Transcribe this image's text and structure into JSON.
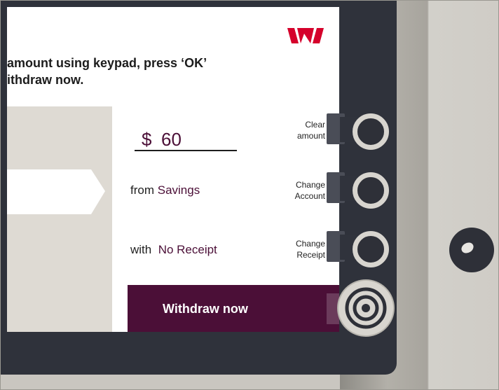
{
  "brand": {
    "logo_icon": "westpac-logo",
    "color": "#d5002b"
  },
  "instructions": {
    "line1": "amount using keypad, press ‘OK’",
    "line2": "ithdraw now."
  },
  "amount": {
    "currency": "$",
    "value": "60"
  },
  "from": {
    "label": "from",
    "value": "Savings"
  },
  "with": {
    "label": "with",
    "value": "No Receipt"
  },
  "side_buttons": {
    "clear": {
      "line1": "Clear",
      "line2": "amount"
    },
    "account": {
      "line1": "Change",
      "line2": "Account"
    },
    "receipt": {
      "line1": "Change",
      "line2": "Receipt"
    }
  },
  "withdraw_button": {
    "label": "Withdraw now"
  },
  "colors": {
    "accent": "#4b0f37",
    "bezel": "#2f323b"
  }
}
